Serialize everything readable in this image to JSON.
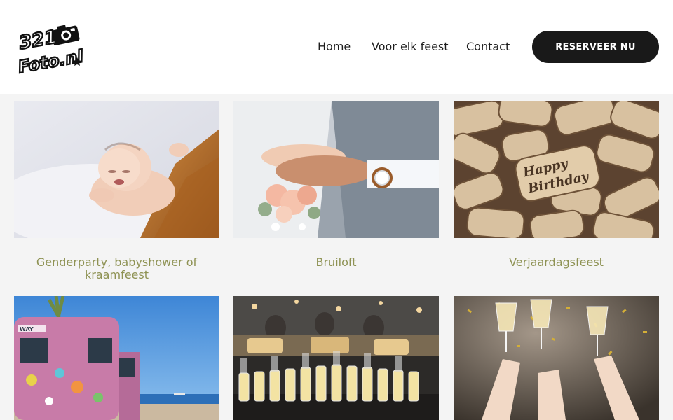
{
  "logo": {
    "text_line1": "321",
    "text_line2": "Foto.nl"
  },
  "nav": {
    "items": [
      {
        "label": "Home"
      },
      {
        "label": "Voor elk feest"
      },
      {
        "label": "Contact"
      }
    ],
    "cta_label": "RESERVEER NU"
  },
  "cards": [
    {
      "caption": "Genderparty, babyshower of kraamfeest",
      "image": "sleeping-baby-photo"
    },
    {
      "caption": "Bruiloft",
      "image": "wedding-hands-photo"
    },
    {
      "caption": "Verjaardagsfeest",
      "image": "wine-corks-happy-birthday-photo"
    },
    {
      "caption": "",
      "image": "painted-van-beach-photo"
    },
    {
      "caption": "",
      "image": "champagne-glasses-event-photo"
    },
    {
      "caption": "",
      "image": "toast-confetti-photo"
    }
  ],
  "colors": {
    "caption": "#8e9253",
    "cta_bg": "#191919",
    "page_bg": "#f4f4f4",
    "header_bg": "#ffffff"
  }
}
